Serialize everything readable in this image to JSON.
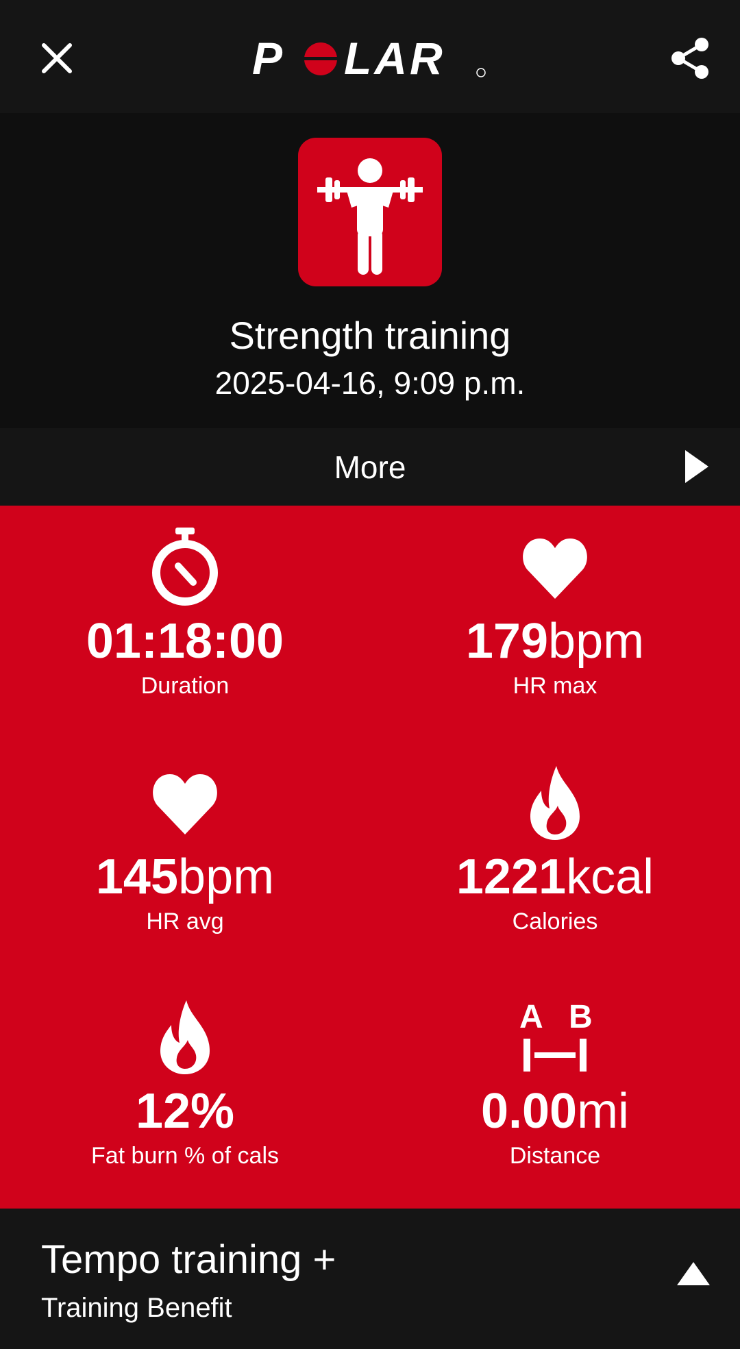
{
  "header": {
    "close_icon": "close-icon",
    "brand": "POLAR",
    "share_icon": "share-icon"
  },
  "session": {
    "sport_icon": "weightlifting-icon",
    "title": "Strength training",
    "datetime": "2025-04-16, 9:09 p.m."
  },
  "more": {
    "label": "More",
    "icon": "play-arrow-icon"
  },
  "stats": [
    {
      "icon": "stopwatch-icon",
      "value": "01:18:00",
      "unit": "",
      "label": "Duration"
    },
    {
      "icon": "heart-icon",
      "value": "179",
      "unit": "bpm",
      "label": "HR max"
    },
    {
      "icon": "heart-icon",
      "value": "145",
      "unit": "bpm",
      "label": "HR avg"
    },
    {
      "icon": "flame-icon",
      "value": "1221",
      "unit": "kcal",
      "label": "Calories"
    },
    {
      "icon": "flame-icon",
      "value": "12%",
      "unit": "",
      "label": "Fat burn % of cals"
    },
    {
      "icon": "distance-ab-icon",
      "value": "0.00",
      "unit": "mi",
      "label": "Distance"
    }
  ],
  "benefit": {
    "title": "Tempo training +",
    "subtitle": "Training Benefit",
    "icon": "expand-up-icon"
  },
  "colors": {
    "accent": "#d0021b",
    "background": "#0f0f0f",
    "bar": "#151515"
  }
}
